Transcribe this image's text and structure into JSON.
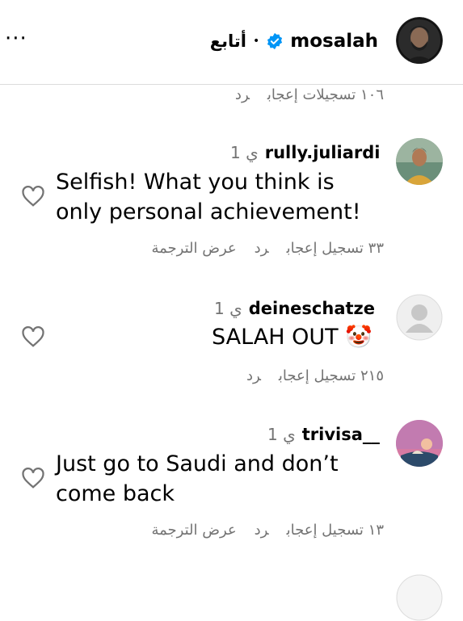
{
  "header": {
    "username": "mosalah",
    "follow_label": "أتابع",
    "separator": "•",
    "more_label": "···",
    "verified_color": "#0095f6"
  },
  "top_meta": {
    "likes": "١٠٦ تسجيلات إعجاب",
    "reply": "رد"
  },
  "comments": [
    {
      "username": "rully.juliardi",
      "time": "1 ي",
      "text_lines": [
        "Selfish! What you think is",
        "only personal achievement!"
      ],
      "likes": "٣٣ تسجيل إعجاب",
      "reply": "رد",
      "translate": "عرض الترجمة"
    },
    {
      "username": "deineschatze",
      "time": "1 ي",
      "text_lines": [
        "SALAH OUT 🤡"
      ],
      "likes": "٢١٥ تسجيل إعجاب",
      "reply": "رد"
    },
    {
      "username": "trivisa__",
      "time": "1 ي",
      "text_lines": [
        "Just go to Saudi and don’t",
        "come back"
      ],
      "likes": "١٣ تسجيل إعجاب",
      "reply": "رد",
      "translate": "عرض الترجمة"
    }
  ],
  "colors": {
    "muted_text": "#737373",
    "divider": "#dbdbdb",
    "heart_stroke": "#737373"
  }
}
